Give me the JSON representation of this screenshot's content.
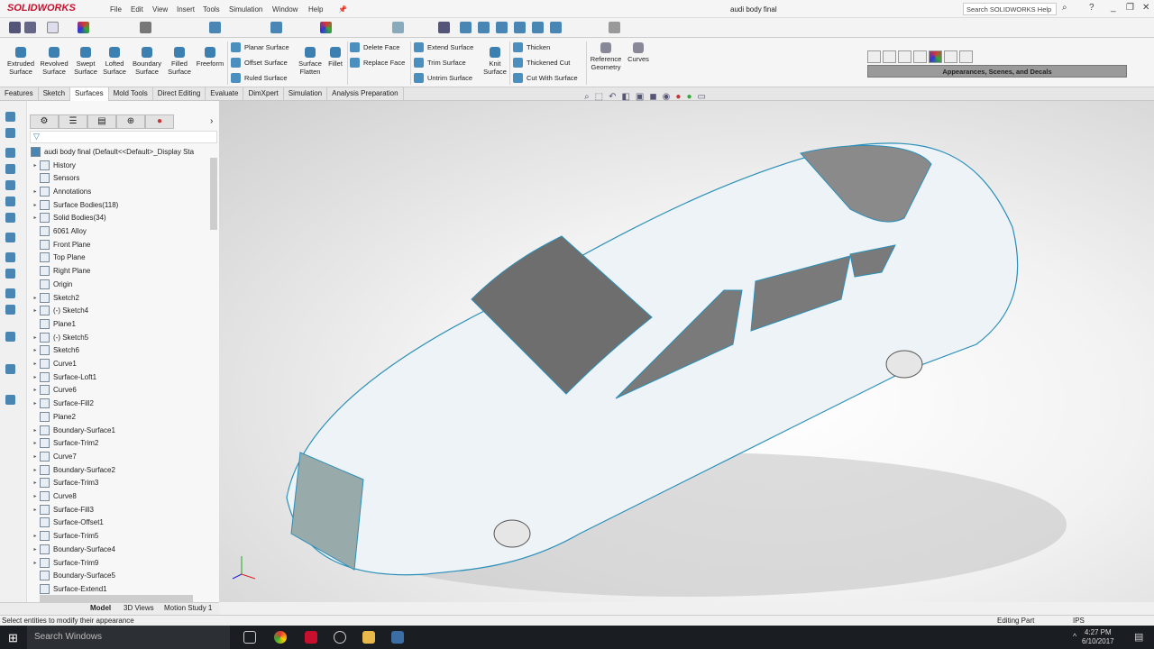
{
  "app": {
    "brand": "SOLIDWORKS",
    "title": "audi body final",
    "help_search": "Search SOLIDWORKS Help"
  },
  "menu": [
    "File",
    "Edit",
    "View",
    "Insert",
    "Tools",
    "Simulation",
    "Window",
    "Help"
  ],
  "ribbon": {
    "large": [
      {
        "label": "Extruded\nSurface"
      },
      {
        "label": "Revolved\nSurface"
      },
      {
        "label": "Swept\nSurface"
      },
      {
        "label": "Lofted\nSurface"
      },
      {
        "label": "Boundary\nSurface"
      },
      {
        "label": "Filled\nSurface"
      },
      {
        "label": "Freeform"
      }
    ],
    "col1": [
      "Planar Surface",
      "Offset Surface",
      "Ruled Surface"
    ],
    "flatten": "Surface\nFlatten",
    "fillet": "Fillet",
    "col2": [
      "Delete Face",
      "Replace Face"
    ],
    "col3": [
      "Extend Surface",
      "Trim Surface",
      "Untrim Surface"
    ],
    "knit": "Knit\nSurface",
    "col4": [
      "Thicken",
      "Thickened Cut",
      "Cut With Surface"
    ],
    "ref_geom": "Reference\nGeometry",
    "curves": "Curves"
  },
  "tabs": [
    "Features",
    "Sketch",
    "Surfaces",
    "Mold Tools",
    "Direct Editing",
    "Evaluate",
    "DimXpert",
    "Simulation",
    "Analysis Preparation"
  ],
  "active_tab": "Surfaces",
  "task_pane": {
    "title": "Appearances, Scenes, and Decals"
  },
  "tree": {
    "root": "audi body final  (Default<<Default>_Display Sta",
    "items": [
      {
        "label": "History",
        "exp": true
      },
      {
        "label": "Sensors",
        "exp": false
      },
      {
        "label": "Annotations",
        "exp": true
      },
      {
        "label": "Surface Bodies(118)",
        "exp": true
      },
      {
        "label": "Solid Bodies(34)",
        "exp": true
      },
      {
        "label": "6061 Alloy",
        "exp": false
      },
      {
        "label": "Front Plane",
        "exp": false
      },
      {
        "label": "Top Plane",
        "exp": false
      },
      {
        "label": "Right Plane",
        "exp": false
      },
      {
        "label": "Origin",
        "exp": false
      },
      {
        "label": "Sketch2",
        "exp": true
      },
      {
        "label": "(-) Sketch4",
        "exp": true
      },
      {
        "label": "Plane1",
        "exp": false
      },
      {
        "label": "(-) Sketch5",
        "exp": true
      },
      {
        "label": "Sketch6",
        "exp": true
      },
      {
        "label": "Curve1",
        "exp": true
      },
      {
        "label": "Surface-Loft1",
        "exp": true
      },
      {
        "label": "Curve6",
        "exp": true
      },
      {
        "label": "Surface-Fill2",
        "exp": true
      },
      {
        "label": "Plane2",
        "exp": false
      },
      {
        "label": "Boundary-Surface1",
        "exp": true
      },
      {
        "label": "Surface-Trim2",
        "exp": true
      },
      {
        "label": "Curve7",
        "exp": true
      },
      {
        "label": "Boundary-Surface2",
        "exp": true
      },
      {
        "label": "Surface-Trim3",
        "exp": true
      },
      {
        "label": "Curve8",
        "exp": true
      },
      {
        "label": "Surface-Fill3",
        "exp": true
      },
      {
        "label": "Surface-Offset1",
        "exp": false
      },
      {
        "label": "Surface-Trim5",
        "exp": true
      },
      {
        "label": "Boundary-Surface4",
        "exp": true
      },
      {
        "label": "Surface-Trim9",
        "exp": true
      },
      {
        "label": "Boundary-Surface5",
        "exp": false
      },
      {
        "label": "Surface-Extend1",
        "exp": false
      }
    ]
  },
  "bottom_tabs": [
    "Model",
    "3D Views",
    "Motion Study 1"
  ],
  "status": {
    "message": "Select entities to modify their appearance",
    "mode": "Editing Part",
    "units": "IPS"
  },
  "taskbar": {
    "search": "Search Windows",
    "time": "4:27 PM",
    "date": "6/10/2017"
  },
  "colors": {
    "accent": "#c8102e",
    "body_edge": "#2a8fb8",
    "taskbar": "#1a1d22"
  }
}
